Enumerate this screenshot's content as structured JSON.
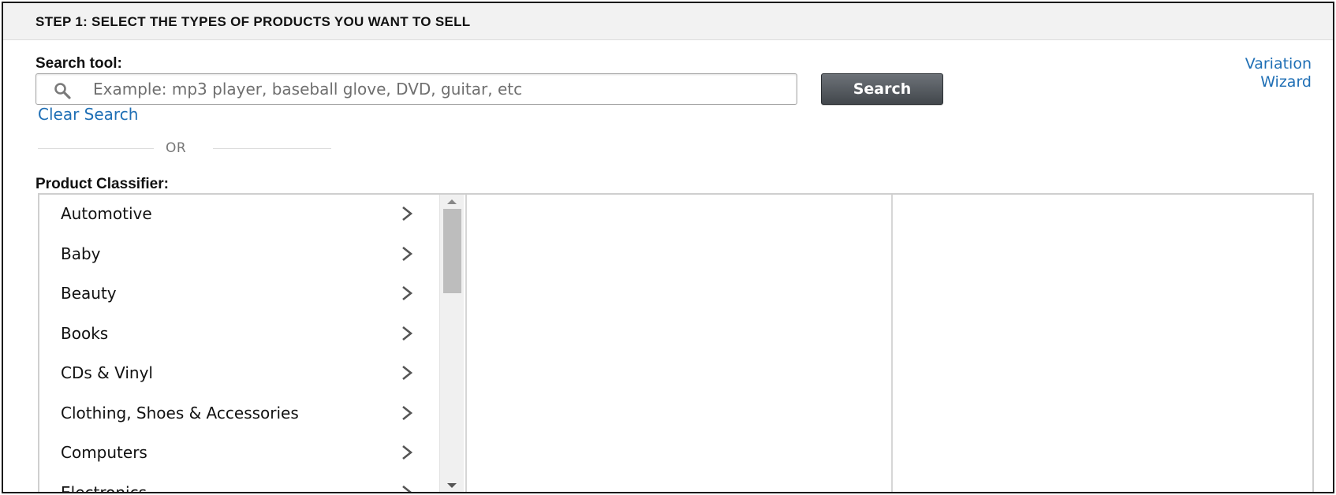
{
  "step_header": {
    "title": "STEP 1: SELECT THE TYPES OF PRODUCTS YOU WANT TO SELL"
  },
  "search": {
    "label": "Search tool:",
    "placeholder": "Example: mp3 player, baseball glove, DVD, guitar, etc",
    "value": "",
    "button_label": "Search",
    "clear_label": "Clear Search"
  },
  "variation_wizard": {
    "line1": "Variation",
    "line2": "Wizard"
  },
  "separator": {
    "text": "OR"
  },
  "classifier": {
    "label": "Product Classifier:",
    "categories": [
      {
        "label": "Automotive"
      },
      {
        "label": "Baby"
      },
      {
        "label": "Beauty"
      },
      {
        "label": "Books"
      },
      {
        "label": "CDs & Vinyl"
      },
      {
        "label": "Clothing, Shoes & Accessories"
      },
      {
        "label": "Computers"
      },
      {
        "label": "Electronics"
      }
    ]
  },
  "colors": {
    "link": "#1f6fb5",
    "button_dark": "#42474c",
    "header_bg": "#f2f2f2"
  }
}
